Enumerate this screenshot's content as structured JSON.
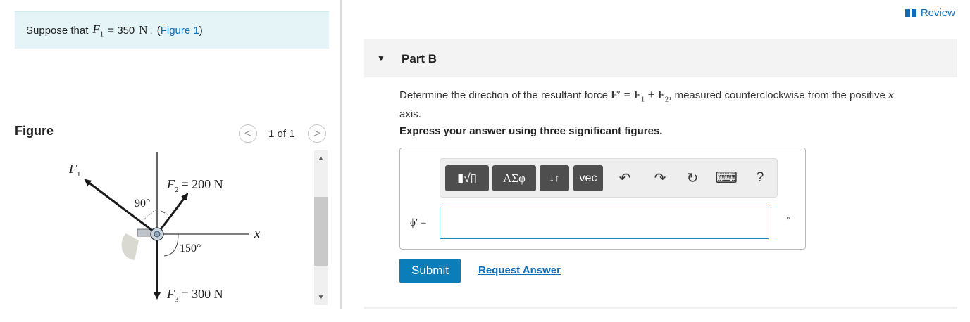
{
  "given": {
    "prefix": "Suppose that",
    "var_main": "F",
    "var_sub": "1",
    "equals_value": "= 350",
    "unit": "N",
    "separator": ".",
    "figure_link": {
      "open": "(",
      "label": "Figure 1",
      "close": ")"
    }
  },
  "figure": {
    "title": "Figure",
    "pager": "1 of 1",
    "prev_glyph": "<",
    "next_glyph": ">",
    "labels": {
      "f1_main": "F",
      "f1_sub": "1",
      "f2_main": "F",
      "f2_sub": "2",
      "f2_value": "= 200 N",
      "f3_main": "F",
      "f3_sub": "3",
      "f3_value": "= 300 N",
      "angle_90": "90°",
      "angle_150": "150°",
      "x_axis": "x"
    }
  },
  "header": {
    "review": "Review"
  },
  "part": {
    "title": "Part B",
    "question_pre": "Determine the direction of the resultant force ",
    "formula": {
      "F": "F",
      "prime": "′",
      "eq": " = ",
      "F1": "F",
      "s1": "1",
      "plus": " + ",
      "F2": "F",
      "s2": "2"
    },
    "question_post": ", measured counterclockwise from the positive ",
    "axis_var": "x",
    "question_end": "axis.",
    "instruction": "Express your answer using three significant figures."
  },
  "toolbar": {
    "templates_glyph": "▮√▯",
    "greek_label": "ΑΣφ",
    "updown_glyph": "↓↑",
    "vec_label": "vec",
    "undo_glyph": "↶",
    "redo_glyph": "↷",
    "reset_glyph": "↻",
    "keyboard_glyph": "⌨",
    "help_glyph": "?"
  },
  "answer": {
    "label": "ϕ′ =",
    "value": "",
    "placeholder": "",
    "unit": "°"
  },
  "actions": {
    "submit": "Submit",
    "request": "Request Answer"
  },
  "colors": {
    "accent": "#0b7db8",
    "link": "#0f6db5",
    "given_bg": "#e5f5f7",
    "toolbar_button": "#4e4e4e"
  }
}
